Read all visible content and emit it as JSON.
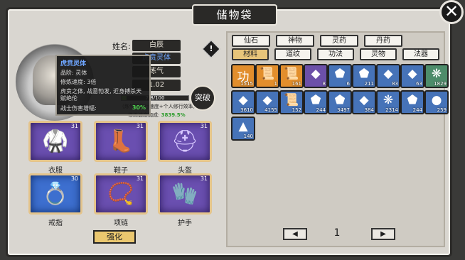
{
  "window": {
    "title": "储物袋",
    "close_label": "✕"
  },
  "character": {
    "name_label": "姓名:",
    "name_value": "白辰",
    "trait_value": "虎贲灵体",
    "stage_value": "练气",
    "speed_value": "1.02",
    "exp_text": "7.8/100",
    "exp_ratio": 0.078,
    "note_line1": "(炼气期修行速度+个人修行效率)",
    "note_line2_label": "修炼速度加成:",
    "note_line2_value": "3839.5%",
    "breakthrough_label": "突破",
    "warning_icon": "!"
  },
  "tooltip": {
    "title": "虎贲灵体",
    "grade": "品阶: 灵体",
    "speed": "修炼速度: 3倍",
    "desc": "虎贲之体, 战意勃发, 近身搏杀天赋绝伦",
    "foot_label": "战士伤害增幅:",
    "foot_value": "30%"
  },
  "equipment": [
    {
      "label": "衣服",
      "level": "31",
      "icon": "robe-icon",
      "glyph": "🥋",
      "quality": "purple"
    },
    {
      "label": "鞋子",
      "level": "31",
      "icon": "boots-icon",
      "glyph": "👢",
      "quality": "purple"
    },
    {
      "label": "头盔",
      "level": "31",
      "icon": "helmet-icon",
      "glyph": "⛑",
      "quality": "purple"
    },
    {
      "label": "戒指",
      "level": "30",
      "icon": "ring-icon",
      "glyph": "💍",
      "quality": "blue"
    },
    {
      "label": "项链",
      "level": "31",
      "icon": "necklace-icon",
      "glyph": "📿",
      "quality": "purple"
    },
    {
      "label": "护手",
      "level": "31",
      "icon": "gauntlet-icon",
      "glyph": "🧤",
      "quality": "purple"
    }
  ],
  "strengthen_label": "强化",
  "category_tabs_row1": [
    "仙石",
    "神物",
    "灵药",
    "丹药"
  ],
  "category_tabs_row2": [
    "材料",
    "道纹",
    "功法",
    "灵物",
    "法器"
  ],
  "active_tab": "材料",
  "inventory": [
    {
      "icon": "scroll-icon",
      "glyph": "功",
      "count": "1515",
      "quality": "orange"
    },
    {
      "icon": "scroll-icon",
      "glyph": "📜",
      "count": "1",
      "quality": "orange"
    },
    {
      "icon": "scroll-icon",
      "glyph": "📜",
      "count": "161",
      "quality": "orange"
    },
    {
      "icon": "crystal-icon",
      "glyph": "◆",
      "count": "8",
      "quality": "purple"
    },
    {
      "icon": "ore-icon",
      "glyph": "⬟",
      "count": "6",
      "quality": "blue"
    },
    {
      "icon": "ore-icon",
      "glyph": "⬟",
      "count": "211",
      "quality": "blue"
    },
    {
      "icon": "crystal-icon",
      "glyph": "◆",
      "count": "83",
      "quality": "blue"
    },
    {
      "icon": "crystal-icon",
      "glyph": "◆",
      "count": "63",
      "quality": "blue"
    },
    {
      "icon": "herb-icon",
      "glyph": "❋",
      "count": "1829",
      "quality": "green"
    },
    {
      "icon": "crystal-icon",
      "glyph": "◆",
      "count": "3610",
      "quality": "blue"
    },
    {
      "icon": "crystal-icon",
      "glyph": "◆",
      "count": "4155",
      "quality": "blue"
    },
    {
      "icon": "scroll-icon",
      "glyph": "📜",
      "count": "152",
      "quality": "blue"
    },
    {
      "icon": "ore-icon",
      "glyph": "⬟",
      "count": "244",
      "quality": "blue"
    },
    {
      "icon": "ore-icon",
      "glyph": "⬟",
      "count": "3497",
      "quality": "blue"
    },
    {
      "icon": "crystal-icon",
      "glyph": "◆",
      "count": "384",
      "quality": "blue"
    },
    {
      "icon": "herb-icon",
      "glyph": "❋",
      "count": "2314",
      "quality": "blue"
    },
    {
      "icon": "ore-icon",
      "glyph": "⬟",
      "count": "244",
      "quality": "blue"
    },
    {
      "icon": "orb-icon",
      "glyph": "●",
      "count": "259",
      "quality": "blue"
    },
    {
      "icon": "powder-icon",
      "glyph": "▲",
      "count": "140",
      "quality": "blue"
    }
  ],
  "pager": {
    "prev": "◀",
    "next": "▶",
    "page": "1"
  }
}
